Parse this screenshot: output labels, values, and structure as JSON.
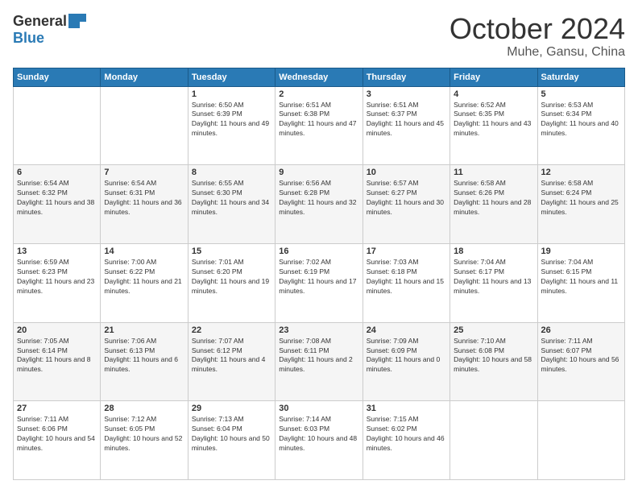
{
  "header": {
    "logo_general": "General",
    "logo_blue": "Blue",
    "month_title": "October 2024",
    "location": "Muhe, Gansu, China"
  },
  "days_of_week": [
    "Sunday",
    "Monday",
    "Tuesday",
    "Wednesday",
    "Thursday",
    "Friday",
    "Saturday"
  ],
  "weeks": [
    [
      {
        "day": "",
        "info": ""
      },
      {
        "day": "",
        "info": ""
      },
      {
        "day": "1",
        "info": "Sunrise: 6:50 AM\nSunset: 6:39 PM\nDaylight: 11 hours and 49 minutes."
      },
      {
        "day": "2",
        "info": "Sunrise: 6:51 AM\nSunset: 6:38 PM\nDaylight: 11 hours and 47 minutes."
      },
      {
        "day": "3",
        "info": "Sunrise: 6:51 AM\nSunset: 6:37 PM\nDaylight: 11 hours and 45 minutes."
      },
      {
        "day": "4",
        "info": "Sunrise: 6:52 AM\nSunset: 6:35 PM\nDaylight: 11 hours and 43 minutes."
      },
      {
        "day": "5",
        "info": "Sunrise: 6:53 AM\nSunset: 6:34 PM\nDaylight: 11 hours and 40 minutes."
      }
    ],
    [
      {
        "day": "6",
        "info": "Sunrise: 6:54 AM\nSunset: 6:32 PM\nDaylight: 11 hours and 38 minutes."
      },
      {
        "day": "7",
        "info": "Sunrise: 6:54 AM\nSunset: 6:31 PM\nDaylight: 11 hours and 36 minutes."
      },
      {
        "day": "8",
        "info": "Sunrise: 6:55 AM\nSunset: 6:30 PM\nDaylight: 11 hours and 34 minutes."
      },
      {
        "day": "9",
        "info": "Sunrise: 6:56 AM\nSunset: 6:28 PM\nDaylight: 11 hours and 32 minutes."
      },
      {
        "day": "10",
        "info": "Sunrise: 6:57 AM\nSunset: 6:27 PM\nDaylight: 11 hours and 30 minutes."
      },
      {
        "day": "11",
        "info": "Sunrise: 6:58 AM\nSunset: 6:26 PM\nDaylight: 11 hours and 28 minutes."
      },
      {
        "day": "12",
        "info": "Sunrise: 6:58 AM\nSunset: 6:24 PM\nDaylight: 11 hours and 25 minutes."
      }
    ],
    [
      {
        "day": "13",
        "info": "Sunrise: 6:59 AM\nSunset: 6:23 PM\nDaylight: 11 hours and 23 minutes."
      },
      {
        "day": "14",
        "info": "Sunrise: 7:00 AM\nSunset: 6:22 PM\nDaylight: 11 hours and 21 minutes."
      },
      {
        "day": "15",
        "info": "Sunrise: 7:01 AM\nSunset: 6:20 PM\nDaylight: 11 hours and 19 minutes."
      },
      {
        "day": "16",
        "info": "Sunrise: 7:02 AM\nSunset: 6:19 PM\nDaylight: 11 hours and 17 minutes."
      },
      {
        "day": "17",
        "info": "Sunrise: 7:03 AM\nSunset: 6:18 PM\nDaylight: 11 hours and 15 minutes."
      },
      {
        "day": "18",
        "info": "Sunrise: 7:04 AM\nSunset: 6:17 PM\nDaylight: 11 hours and 13 minutes."
      },
      {
        "day": "19",
        "info": "Sunrise: 7:04 AM\nSunset: 6:15 PM\nDaylight: 11 hours and 11 minutes."
      }
    ],
    [
      {
        "day": "20",
        "info": "Sunrise: 7:05 AM\nSunset: 6:14 PM\nDaylight: 11 hours and 8 minutes."
      },
      {
        "day": "21",
        "info": "Sunrise: 7:06 AM\nSunset: 6:13 PM\nDaylight: 11 hours and 6 minutes."
      },
      {
        "day": "22",
        "info": "Sunrise: 7:07 AM\nSunset: 6:12 PM\nDaylight: 11 hours and 4 minutes."
      },
      {
        "day": "23",
        "info": "Sunrise: 7:08 AM\nSunset: 6:11 PM\nDaylight: 11 hours and 2 minutes."
      },
      {
        "day": "24",
        "info": "Sunrise: 7:09 AM\nSunset: 6:09 PM\nDaylight: 11 hours and 0 minutes."
      },
      {
        "day": "25",
        "info": "Sunrise: 7:10 AM\nSunset: 6:08 PM\nDaylight: 10 hours and 58 minutes."
      },
      {
        "day": "26",
        "info": "Sunrise: 7:11 AM\nSunset: 6:07 PM\nDaylight: 10 hours and 56 minutes."
      }
    ],
    [
      {
        "day": "27",
        "info": "Sunrise: 7:11 AM\nSunset: 6:06 PM\nDaylight: 10 hours and 54 minutes."
      },
      {
        "day": "28",
        "info": "Sunrise: 7:12 AM\nSunset: 6:05 PM\nDaylight: 10 hours and 52 minutes."
      },
      {
        "day": "29",
        "info": "Sunrise: 7:13 AM\nSunset: 6:04 PM\nDaylight: 10 hours and 50 minutes."
      },
      {
        "day": "30",
        "info": "Sunrise: 7:14 AM\nSunset: 6:03 PM\nDaylight: 10 hours and 48 minutes."
      },
      {
        "day": "31",
        "info": "Sunrise: 7:15 AM\nSunset: 6:02 PM\nDaylight: 10 hours and 46 minutes."
      },
      {
        "day": "",
        "info": ""
      },
      {
        "day": "",
        "info": ""
      }
    ]
  ]
}
